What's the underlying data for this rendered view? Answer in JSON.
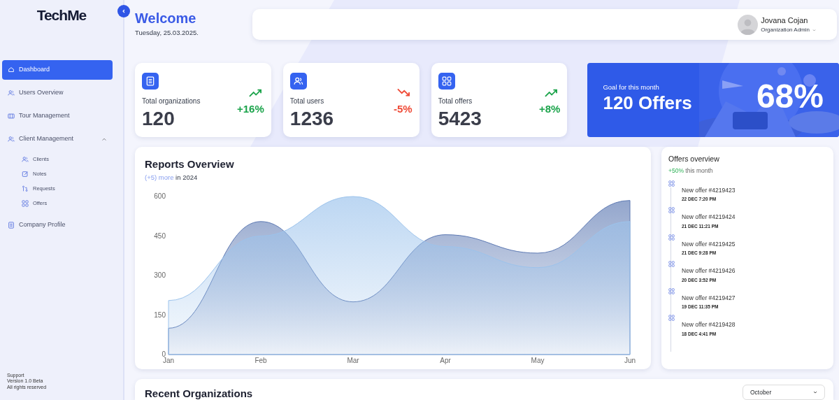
{
  "sidebar": {
    "logo": "TechMe",
    "items": [
      {
        "label": "Dashboard",
        "selected": true
      },
      {
        "label": "Users Overview",
        "selected": false
      },
      {
        "label": "Tour Management",
        "selected": false
      },
      {
        "label": "Client Management",
        "selected": false,
        "expanded": true,
        "children": [
          {
            "label": "Clients",
            "selected": false
          },
          {
            "label": "Notes",
            "selected": false
          },
          {
            "label": "Requests",
            "selected": false
          },
          {
            "label": "Offers",
            "selected": false
          }
        ]
      },
      {
        "label": "Company Profile",
        "selected": false
      }
    ],
    "footer": [
      "Support",
      "Version 1.0 Beta",
      "All rights reserved"
    ]
  },
  "header": {
    "title": "Welcome",
    "date": "Tuesday, 25.03.2025.",
    "user": {
      "name": "Jovana Cojan",
      "role": "Organization Admin"
    }
  },
  "stats": [
    {
      "label": "Total organizations",
      "value": "120",
      "change": "+16%",
      "rising": true
    },
    {
      "label": "Total users",
      "value": "1236",
      "change": "-5%",
      "rising": false
    },
    {
      "label": "Total offers",
      "value": "5423",
      "change": "+8%",
      "rising": true
    }
  ],
  "goal": {
    "label": "Goal for this month",
    "target": "120 Offers",
    "percent": "68%"
  },
  "reports": {
    "title": "Reports Overview",
    "highlight": "(+5) more",
    "subtitle": "in 2024",
    "chart_data": {
      "type": "area",
      "categories": [
        "Jan",
        "Feb",
        "Mar",
        "Apr",
        "May",
        "Jun"
      ],
      "ylim": [
        0,
        600
      ],
      "yticks": [
        0,
        150,
        300,
        450,
        600
      ],
      "series": [
        {
          "color": "#9cc3ec",
          "values": [
            205,
            450,
            600,
            410,
            330,
            505
          ]
        },
        {
          "color": "#5f7bb4",
          "values": [
            100,
            505,
            200,
            455,
            385,
            585
          ]
        }
      ]
    }
  },
  "offers_overview": {
    "title": "Offers overview",
    "change": "+50%",
    "period": "this month",
    "items": [
      {
        "title": "New offer #4219423",
        "time": "22 DEC 7:20 PM"
      },
      {
        "title": "New offer #4219424",
        "time": "21 DEC 11:21 PM"
      },
      {
        "title": "New offer #4219425",
        "time": "21 DEC 9:28 PM"
      },
      {
        "title": "New offer #4219426",
        "time": "20 DEC 3:52 PM"
      },
      {
        "title": "New offer #4219427",
        "time": "19 DEC 11:35 PM"
      },
      {
        "title": "New offer #4219428",
        "time": "18 DEC 4:41 PM"
      }
    ]
  },
  "recent": {
    "title": "Recent Organizations",
    "month": "October"
  }
}
